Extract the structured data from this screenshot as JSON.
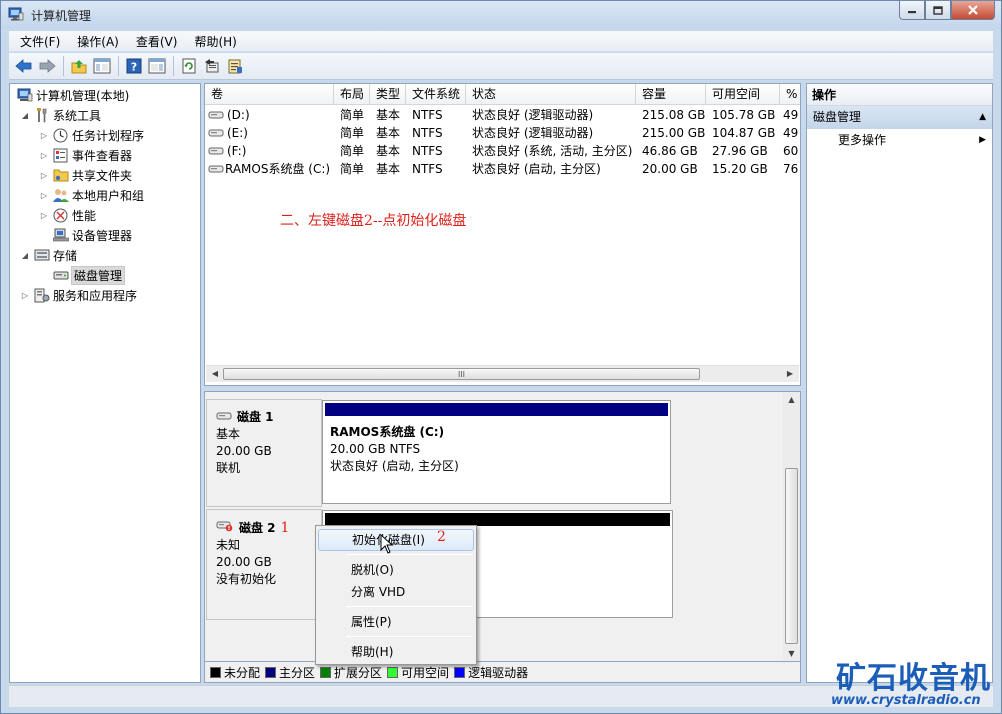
{
  "window": {
    "title": "计算机管理"
  },
  "menubar": {
    "items": [
      "文件(F)",
      "操作(A)",
      "查看(V)",
      "帮助(H)"
    ]
  },
  "toolbar": {
    "buttons": [
      "back-icon",
      "forward-icon",
      "up-folder-icon",
      "console-tree-icon",
      "help-icon",
      "show-pane-icon",
      "refresh-icon",
      "export-icon",
      "properties-icon"
    ]
  },
  "tree": {
    "items": [
      {
        "label": "计算机管理(本地)",
        "icon": "computer-management-icon",
        "level": 0,
        "expander": ""
      },
      {
        "label": "系统工具",
        "icon": "tools-icon",
        "level": 1,
        "expander": "expanded"
      },
      {
        "label": "任务计划程序",
        "icon": "clock-icon",
        "level": 2,
        "expander": "collapsed"
      },
      {
        "label": "事件查看器",
        "icon": "event-viewer-icon",
        "level": 2,
        "expander": "collapsed"
      },
      {
        "label": "共享文件夹",
        "icon": "shared-folder-icon",
        "level": 2,
        "expander": "collapsed"
      },
      {
        "label": "本地用户和组",
        "icon": "users-icon",
        "level": 2,
        "expander": "collapsed"
      },
      {
        "label": "性能",
        "icon": "performance-icon",
        "level": 2,
        "expander": "collapsed"
      },
      {
        "label": "设备管理器",
        "icon": "device-manager-icon",
        "level": 2,
        "expander": ""
      },
      {
        "label": "存储",
        "icon": "storage-icon",
        "level": 1,
        "expander": "expanded"
      },
      {
        "label": "磁盘管理",
        "icon": "disk-management-icon",
        "level": 2,
        "expander": "",
        "selected": true
      },
      {
        "label": "服务和应用程序",
        "icon": "services-icon",
        "level": 1,
        "expander": "collapsed"
      }
    ]
  },
  "volumes": {
    "columns": [
      "卷",
      "布局",
      "类型",
      "文件系统",
      "状态",
      "容量",
      "可用空间",
      "%"
    ],
    "rows": [
      [
        "(D:)",
        "简单",
        "基本",
        "NTFS",
        "状态良好 (逻辑驱动器)",
        "215.08 GB",
        "105.78 GB",
        "49"
      ],
      [
        "(E:)",
        "简单",
        "基本",
        "NTFS",
        "状态良好 (逻辑驱动器)",
        "215.00 GB",
        "104.87 GB",
        "49"
      ],
      [
        "(F:)",
        "简单",
        "基本",
        "NTFS",
        "状态良好 (系统, 活动, 主分区)",
        "46.86 GB",
        "27.96 GB",
        "60"
      ],
      [
        "RAMOS系统盘 (C:)",
        "简单",
        "基本",
        "NTFS",
        "状态良好 (启动, 主分区)",
        "20.00 GB",
        "15.20 GB",
        "76"
      ]
    ],
    "annotation": "二、左键磁盘2--点初始化磁盘",
    "hscroll_label": "III"
  },
  "disks": [
    {
      "name": "磁盘 1",
      "type": "基本",
      "size": "20.00 GB",
      "status": "联机",
      "partition": {
        "name": "RAMOS系统盘  (C:)",
        "detail": "20.00 GB NTFS",
        "status": "状态良好 (启动, 主分区)",
        "color": "#000080"
      }
    },
    {
      "name": "磁盘 2",
      "type": "未知",
      "size": "20.00 GB",
      "status": "没有初始化",
      "marker": "1",
      "partition": {
        "color": "#000000"
      }
    }
  ],
  "legend": [
    {
      "label": "未分配",
      "color": "#000000"
    },
    {
      "label": "主分区",
      "color": "#000080"
    },
    {
      "label": "扩展分区",
      "color": "#008000"
    },
    {
      "label": "可用空间",
      "color": "#33ff33"
    },
    {
      "label": "逻辑驱动器",
      "color": "#0000ff"
    }
  ],
  "context_menu": {
    "items": [
      "初始化磁盘(I)",
      "脱机(O)",
      "分离 VHD",
      "属性(P)",
      "帮助(H)"
    ],
    "marker": "2"
  },
  "actions": {
    "header": "操作",
    "section": "磁盘管理",
    "more": "更多操作"
  },
  "watermark": {
    "title": "矿石收音机",
    "url": "www.crystalradio.cn"
  }
}
